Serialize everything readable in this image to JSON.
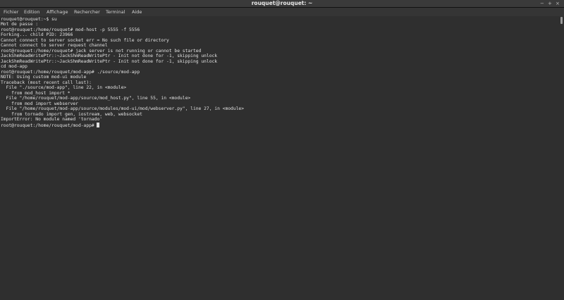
{
  "window": {
    "title": "rouquet@rouquet: ~",
    "minimize": "−",
    "maximize": "+",
    "close": "×"
  },
  "menu": [
    "Fichier",
    "Edition",
    "Affichage",
    "Rechercher",
    "Terminal",
    "Aide"
  ],
  "terminal": {
    "lines": [
      "rouquet@rouquet:~$ su",
      "Mot de passe :",
      "root@rouquet:/home/rouquet# mod-host -p 5555 -f 5556",
      "Forking... child PID: 23966",
      "Cannot connect to server socket err = No such file or directory",
      "Cannot connect to server request channel",
      "root@rouquet:/home/rouquet# jack server is not running or cannot be started",
      "JackShmReadWritePtr::~JackShmReadWritePtr - Init not done for -1, skipping unlock",
      "JackShmReadWritePtr::~JackShmReadWritePtr - Init not done for -1, skipping unlock",
      "cd mod-app",
      "root@rouquet:/home/rouquet/mod-app# ./source/mod-app",
      "NOTE: Using custom mod-ui module",
      "Traceback (most recent call last):",
      "  File \"./source/mod-app\", line 22, in <module>",
      "    from mod_host import *",
      "  File \"/home/rouquet/mod-app/source/mod_host.py\", line 55, in <module>",
      "    from mod import webserver",
      "  File \"/home/rouquet/mod-app/source/modules/mod-ui/mod/webserver.py\", line 27, in <module>",
      "    from tornado import gen, iostream, web, websocket",
      "ImportError: No module named 'tornado'"
    ],
    "prompt": "root@rouquet:/home/rouquet/mod-app# "
  }
}
